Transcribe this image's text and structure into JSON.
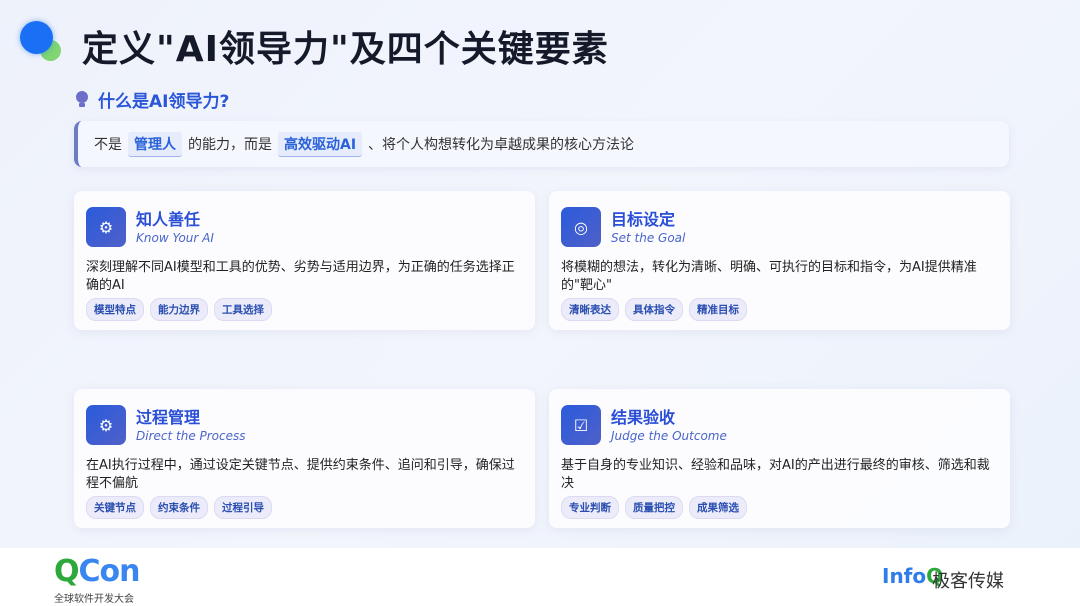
{
  "header": {
    "title": "定义\"AI领导力\"及四个关键要素"
  },
  "definition": {
    "heading": "什么是AI领导力?",
    "text_1": "不是",
    "highlight_1": "管理人",
    "text_2": "的能力，而是",
    "highlight_2": "高效驱动AI",
    "text_3": "、将个人构想转化为卓越成果的核心方法论"
  },
  "cards": [
    {
      "title": "知人善任",
      "subtitle": "Know Your AI",
      "description": "深刻理解不同AI模型和工具的优势、劣势与适用边界，为正确的任务选择正确的AI",
      "tags": [
        "模型特点",
        "能力边界",
        "工具选择"
      ],
      "icon": "head-gear-icon"
    },
    {
      "title": "目标设定",
      "subtitle": "Set the Goal",
      "description": "将模糊的想法，转化为清晰、明确、可执行的目标和指令，为AI提供精准的\"靶心\"",
      "tags": [
        "清晰表达",
        "具体指令",
        "精准目标"
      ],
      "icon": "target-icon"
    },
    {
      "title": "过程管理",
      "subtitle": "Direct the Process",
      "description": "在AI执行过程中，通过设定关键节点、提供约束条件、追问和引导，确保过程不偏航",
      "tags": [
        "关键节点",
        "约束条件",
        "过程引导"
      ],
      "icon": "gear-icon"
    },
    {
      "title": "结果验收",
      "subtitle": "Judge the Outcome",
      "description": "基于自身的专业知识、经验和品味，对AI的产出进行最终的审核、筛选和裁决",
      "tags": [
        "专业判断",
        "质量把控",
        "成果筛选"
      ],
      "icon": "checklist-icon"
    }
  ],
  "footer": {
    "qcon_q": "Q",
    "qcon_con": "Con",
    "qcon_sub": "全球软件开发大会",
    "infoq_info": "Info",
    "infoq_q": "Q",
    "infoq_cn": "极客传媒"
  }
}
